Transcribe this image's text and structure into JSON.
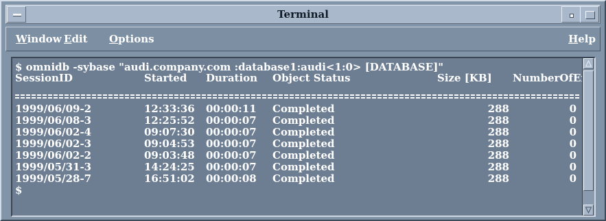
{
  "window": {
    "title": "Terminal"
  },
  "menubar": {
    "items": [
      {
        "pre": "",
        "mnemonic": "W",
        "rest": "indow"
      },
      {
        "pre": "",
        "mnemonic": "E",
        "rest": "dit"
      },
      {
        "pre": "",
        "mnemonic": "O",
        "rest": "ptions"
      }
    ],
    "help": {
      "pre": "",
      "mnemonic": "H",
      "rest": "elp"
    }
  },
  "terminal": {
    "command": "$ omnidb -sybase \"audi.company.com :database1:audi<1:0> [DATABASE]\"",
    "headers": [
      "SessionID",
      "Started",
      "Duration",
      "Object Status",
      "Size [KB]",
      "NumberOfEr"
    ],
    "rows": [
      [
        "1999/06/09-2",
        "12:33:36",
        "00:00:11",
        "Completed",
        "288",
        "0"
      ],
      [
        "1999/06/08-3",
        "12:25:52",
        "00:00:07",
        "Completed",
        "288",
        "0"
      ],
      [
        "1999/06/02-4",
        "09:07:30",
        "00:00:07",
        "Completed",
        "288",
        "0"
      ],
      [
        "1999/06/02-3",
        "09:04:53",
        "00:00:07",
        "Completed",
        "288",
        "0"
      ],
      [
        "1999/06/02-2",
        "09:03:48",
        "00:00:07",
        "Completed",
        "288",
        "0"
      ],
      [
        "1999/05/31-3",
        "14:24:25",
        "00:00:07",
        "Completed",
        "288",
        "0"
      ],
      [
        "1999/05/28-7",
        "16:51:02",
        "00:00:08",
        "Completed",
        "288",
        "0"
      ]
    ],
    "prompt": "$"
  },
  "colors": {
    "titlebar": "#a9b9cb",
    "menubar": "#7d8fa3",
    "terminal_bg": "#6d7e93",
    "text": "#ffffff"
  }
}
